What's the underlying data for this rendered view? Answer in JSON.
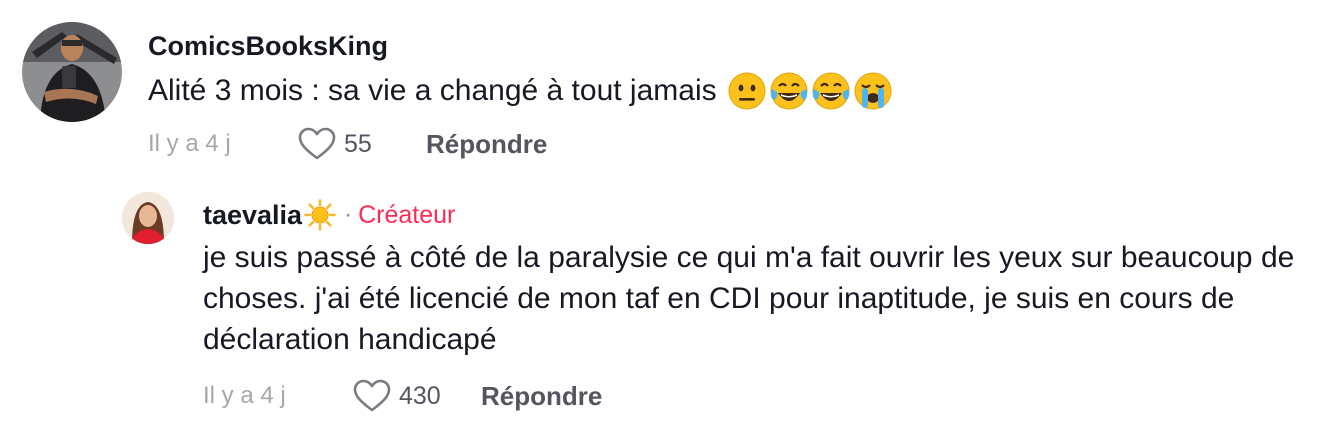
{
  "comment": {
    "username": "ComicsBooksKing",
    "text": "Alité 3 mois : sa vie a changé à tout jamais",
    "emojis": [
      "neutral-face-emoji",
      "tears-of-joy-emoji",
      "tears-of-joy-emoji",
      "loudly-crying-face-emoji"
    ],
    "time": "Il y a 4 j",
    "likes": "55",
    "reply_label": "Répondre"
  },
  "reply": {
    "username": "taevalia",
    "username_icon": "sun-emoji",
    "separator": "·",
    "badge": "Créateur",
    "text": "je suis passé à côté de la paralysie ce qui m'a fait ouvrir les yeux sur beaucoup de choses. j'ai été licencié de mon taf en CDI pour inaptitude, je suis en cours de déclaration handicapé",
    "time": "Il y a 4 j",
    "likes": "430",
    "reply_label": "Répondre"
  },
  "colors": {
    "text": "#161823",
    "secondary": "#545560",
    "muted": "#a6a7ab",
    "creator_badge": "#fe2c55"
  }
}
